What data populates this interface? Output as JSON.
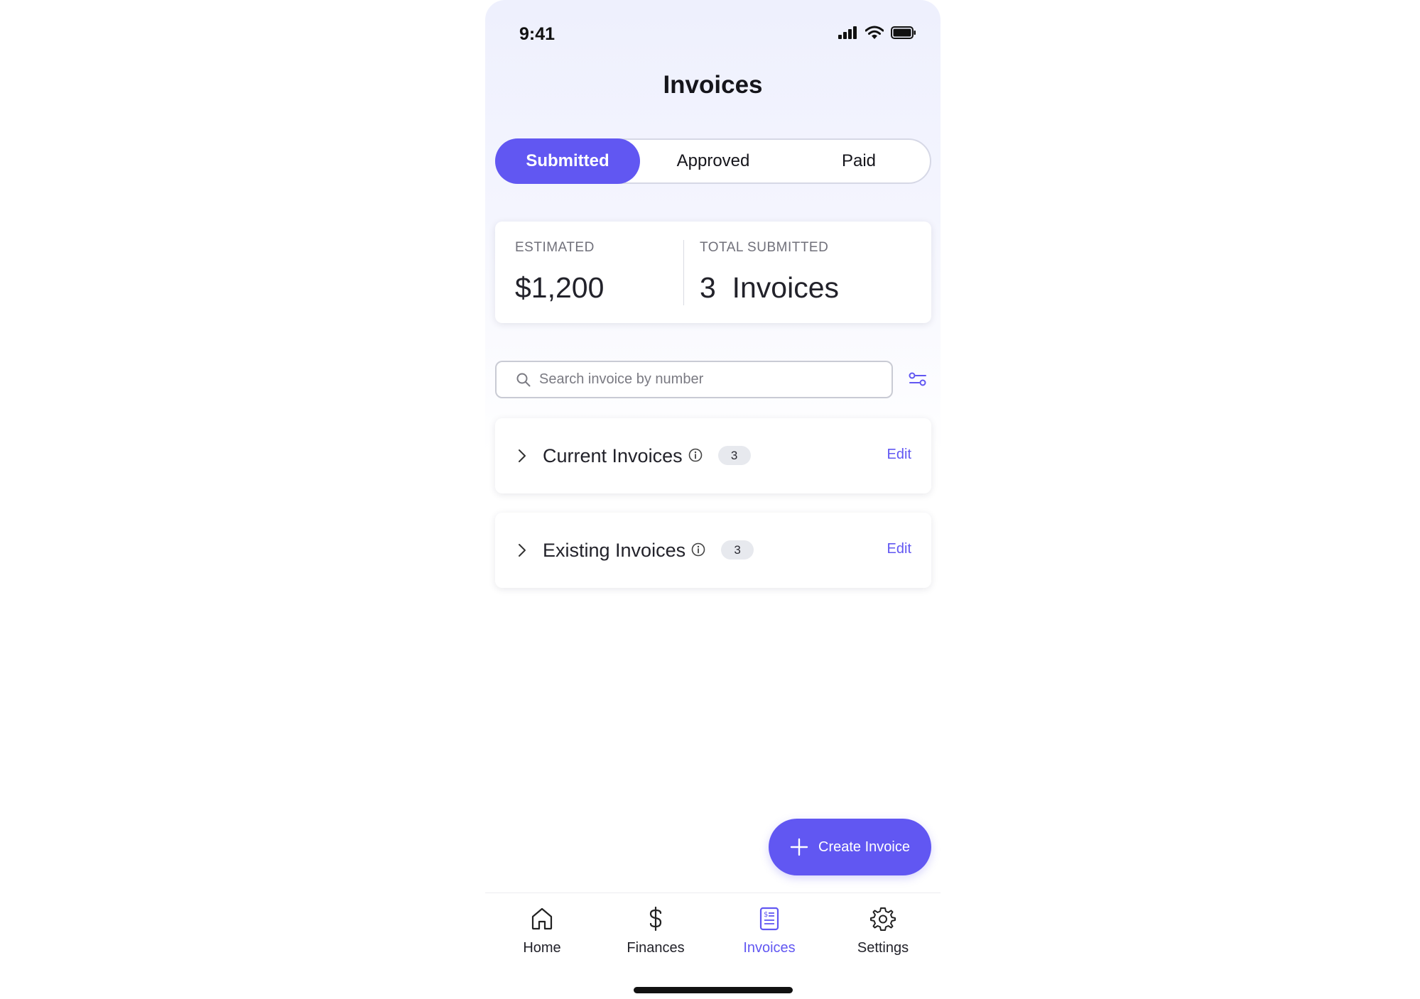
{
  "status_bar": {
    "time": "9:41"
  },
  "header": {
    "title": "Invoices"
  },
  "tabs": [
    {
      "label": "Submitted",
      "active": true
    },
    {
      "label": "Approved",
      "active": false
    },
    {
      "label": "Paid",
      "active": false
    }
  ],
  "summary": {
    "estimated_label": "ESTIMATED",
    "estimated_value": "$1,200",
    "total_label": "TOTAL SUBMITTED",
    "total_value": "3  Invoices"
  },
  "search": {
    "placeholder": "Search invoice by number",
    "value": ""
  },
  "sections": [
    {
      "title": "Current Invoices",
      "count": "3",
      "action": "Edit"
    },
    {
      "title": "Existing Invoices",
      "count": "3",
      "action": "Edit"
    }
  ],
  "fab": {
    "label": "Create Invoice"
  },
  "bottom_nav": [
    {
      "label": "Home",
      "icon": "home-icon",
      "active": false
    },
    {
      "label": "Finances",
      "icon": "dollar-icon",
      "active": false
    },
    {
      "label": "Invoices",
      "icon": "invoice-icon",
      "active": true
    },
    {
      "label": "Settings",
      "icon": "gear-icon",
      "active": false
    }
  ],
  "colors": {
    "accent": "#6157f2",
    "text": "#22222a",
    "muted": "#70707a"
  }
}
